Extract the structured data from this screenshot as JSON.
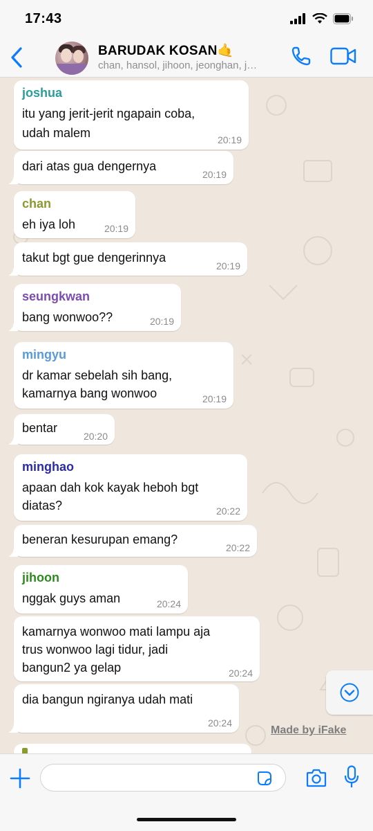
{
  "status": {
    "time": "17:43"
  },
  "header": {
    "title": "BARUDAK KOSAN🤙",
    "subtitle": "chan, hansol, jihoon, jeonghan, j…"
  },
  "colors": {
    "accent": "#0a7cff",
    "joshua": "#2a9d9a",
    "chan": "#8a9a2e",
    "seungkwan": "#7d4cb0",
    "mingyu": "#5a9ad8",
    "minghao": "#2b2ba6",
    "jihoon": "#2e8a1f"
  },
  "messages": [
    {
      "sender": "joshua",
      "lines": [
        "itu yang jerit-jerit ngapain coba,",
        "udah malem"
      ],
      "time": "20:19"
    },
    {
      "sender": "",
      "lines": [
        "dari atas gua dengernya"
      ],
      "time": "20:19"
    },
    {
      "sender": "chan",
      "lines": [
        "eh iya loh"
      ],
      "time": "20:19"
    },
    {
      "sender": "",
      "lines": [
        "takut bgt gue dengerinnya"
      ],
      "time": "20:19"
    },
    {
      "sender": "seungkwan",
      "lines": [
        "bang wonwoo??"
      ],
      "time": "20:19"
    },
    {
      "sender": "mingyu",
      "lines": [
        "dr kamar sebelah sih bang,",
        "kamarnya bang wonwoo"
      ],
      "time": "20:19"
    },
    {
      "sender": "",
      "lines": [
        "bentar"
      ],
      "time": "20:20"
    },
    {
      "sender": "minghao",
      "lines": [
        "apaan dah kok kayak heboh bgt",
        "diatas?"
      ],
      "time": "20:22"
    },
    {
      "sender": "",
      "lines": [
        "beneran kesurupan emang?"
      ],
      "time": "20:22"
    },
    {
      "sender": "jihoon",
      "lines": [
        "nggak guys aman"
      ],
      "time": "20:24"
    },
    {
      "sender": "",
      "lines": [
        "kamarnya wonwoo mati lampu aja",
        "trus wonwoo lagi tidur, jadi",
        "bangun2 ya gelap"
      ],
      "time": "20:24"
    },
    {
      "sender": "",
      "lines": [
        "dia bangun ngiranya udah mati"
      ],
      "time": "20:24"
    }
  ],
  "watermark": "Made by iFake",
  "input": {
    "placeholder": ""
  }
}
